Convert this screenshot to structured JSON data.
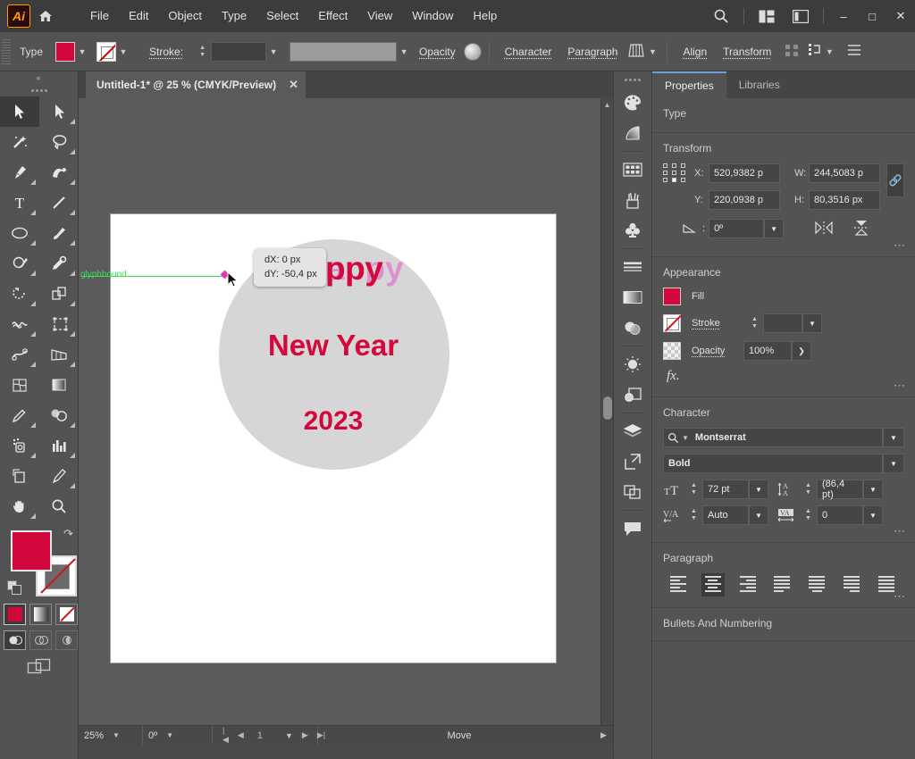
{
  "app": {
    "logo": "Ai",
    "home_icon": "home-icon",
    "search_icon": "search-icon",
    "arrange_icon": "arrange-documents-icon",
    "workspace_icon": "workspace-switcher-icon",
    "minimize": "–",
    "maximize": "□",
    "close": "✕"
  },
  "menu": {
    "items": [
      "File",
      "Edit",
      "Object",
      "Type",
      "Select",
      "Effect",
      "View",
      "Window",
      "Help"
    ]
  },
  "controlbar": {
    "context_label": "Type",
    "fill_color": "#D3093E",
    "stroke_color": "none",
    "stroke_label": "Stroke:",
    "stroke_weight": "",
    "stroke_profile": "",
    "opacity_label": "Opacity",
    "character_label": "Character",
    "paragraph_label": "Paragraph",
    "align_label": "Align",
    "transform_label": "Transform"
  },
  "toolbar": {
    "tools": [
      {
        "name": "selection-tool",
        "selected": true
      },
      {
        "name": "direct-selection-tool",
        "selected": false
      },
      {
        "name": "magic-wand-tool",
        "selected": false
      },
      {
        "name": "lasso-tool",
        "selected": false
      },
      {
        "name": "pen-tool",
        "selected": false
      },
      {
        "name": "curvature-tool",
        "selected": false
      },
      {
        "name": "type-tool",
        "selected": false
      },
      {
        "name": "line-segment-tool",
        "selected": false
      },
      {
        "name": "ellipse-tool",
        "selected": false
      },
      {
        "name": "paintbrush-tool",
        "selected": false
      },
      {
        "name": "shaper-tool",
        "selected": false
      },
      {
        "name": "eyedropper-tool",
        "selected": false
      },
      {
        "name": "rotate-tool",
        "selected": false
      },
      {
        "name": "scale-tool",
        "selected": false
      },
      {
        "name": "width-tool",
        "selected": false
      },
      {
        "name": "free-transform-tool",
        "selected": false
      },
      {
        "name": "puppet-warp-tool",
        "selected": false
      },
      {
        "name": "perspective-grid-tool",
        "selected": false
      },
      {
        "name": "mesh-tool",
        "selected": false
      },
      {
        "name": "gradient-tool",
        "selected": false
      },
      {
        "name": "eyedropper-measure-tool",
        "selected": false
      },
      {
        "name": "blend-tool",
        "selected": false
      },
      {
        "name": "symbol-sprayer-tool",
        "selected": false
      },
      {
        "name": "column-graph-tool",
        "selected": false
      },
      {
        "name": "artboard-tool",
        "selected": false
      },
      {
        "name": "slice-tool",
        "selected": false
      },
      {
        "name": "hand-tool",
        "selected": false
      },
      {
        "name": "zoom-tool",
        "selected": false
      }
    ],
    "fill_color": "#D3093E",
    "stroke_color": "none",
    "color_mode": "color",
    "drawing_mode": "draw-normal"
  },
  "document": {
    "tab_title": "Untitled-1* @ 25 % (CMYK/Preview)",
    "tab_close": "✕"
  },
  "artwork": {
    "line1": "Happy",
    "line1_ghost": "Happy",
    "line2": "New Year",
    "line3": "2023",
    "text_color": "#D3093E",
    "circle_color": "#d6d6d6",
    "smart_guide_label": "glyphbound",
    "smart_guide_color": "#3ddc5a",
    "tooltip_dx": "dX: 0 px",
    "tooltip_dy": "dY: -50,4 px"
  },
  "statusbar": {
    "zoom": "25%",
    "rotation": "0º",
    "artboard_number": "1",
    "tool_status": "Move",
    "first_icon": "|◀",
    "prev_icon": "◀",
    "next_icon": "▶",
    "last_icon": "▶|"
  },
  "dock": {
    "icons": [
      "color-panel-icon",
      "color-guide-icon",
      "swatches-panel-icon",
      "brushes-panel-icon",
      "symbols-panel-icon",
      "stroke-panel-icon",
      "gradient-panel-icon",
      "transparency-panel-icon",
      "appearance-panel-icon",
      "graphic-styles-panel-icon",
      "layers-panel-icon",
      "asset-export-panel-icon",
      "pathfinder-panel-icon",
      "comments-panel-icon"
    ]
  },
  "properties": {
    "tabs": [
      {
        "label": "Properties",
        "active": true
      },
      {
        "label": "Libraries",
        "active": false
      }
    ],
    "type_section_title": "Type",
    "transform": {
      "title": "Transform",
      "x_label": "X:",
      "x_value": "520,9382 p",
      "y_label": "Y:",
      "y_value": "220,0938 p",
      "w_label": "W:",
      "w_value": "244,5083 p",
      "h_label": "H:",
      "h_value": "80,3516 px",
      "angle_value": "0º",
      "link_icon": "link-proportions-icon",
      "flip_h_icon": "flip-horizontal-icon",
      "flip_v_icon": "flip-vertical-icon",
      "more_icon": "more-options-icon"
    },
    "appearance": {
      "title": "Appearance",
      "fill_label": "Fill",
      "fill_color": "#D3093E",
      "stroke_label": "Stroke",
      "stroke_weight": "",
      "opacity_label": "Opacity",
      "opacity_value": "100%",
      "fx_label": "fx.",
      "more_icon": "more-options-icon"
    },
    "character": {
      "title": "Character",
      "font_family": "Montserrat",
      "font_style": "Bold",
      "font_size": "72 pt",
      "leading": "(86,4 pt)",
      "kerning": "Auto",
      "tracking": "0",
      "size_icon": "font-size-icon",
      "leading_icon": "leading-icon",
      "kerning_icon": "kerning-icon",
      "tracking_icon": "tracking-icon"
    },
    "paragraph": {
      "title": "Paragraph",
      "alignments": [
        {
          "name": "align-left",
          "active": false
        },
        {
          "name": "align-center",
          "active": true
        },
        {
          "name": "align-right",
          "active": false
        },
        {
          "name": "justify-last-left",
          "active": false
        },
        {
          "name": "justify-last-center",
          "active": false
        },
        {
          "name": "justify-last-right",
          "active": false
        },
        {
          "name": "justify-all",
          "active": false
        }
      ]
    },
    "bullets": {
      "title": "Bullets And Numbering"
    }
  }
}
